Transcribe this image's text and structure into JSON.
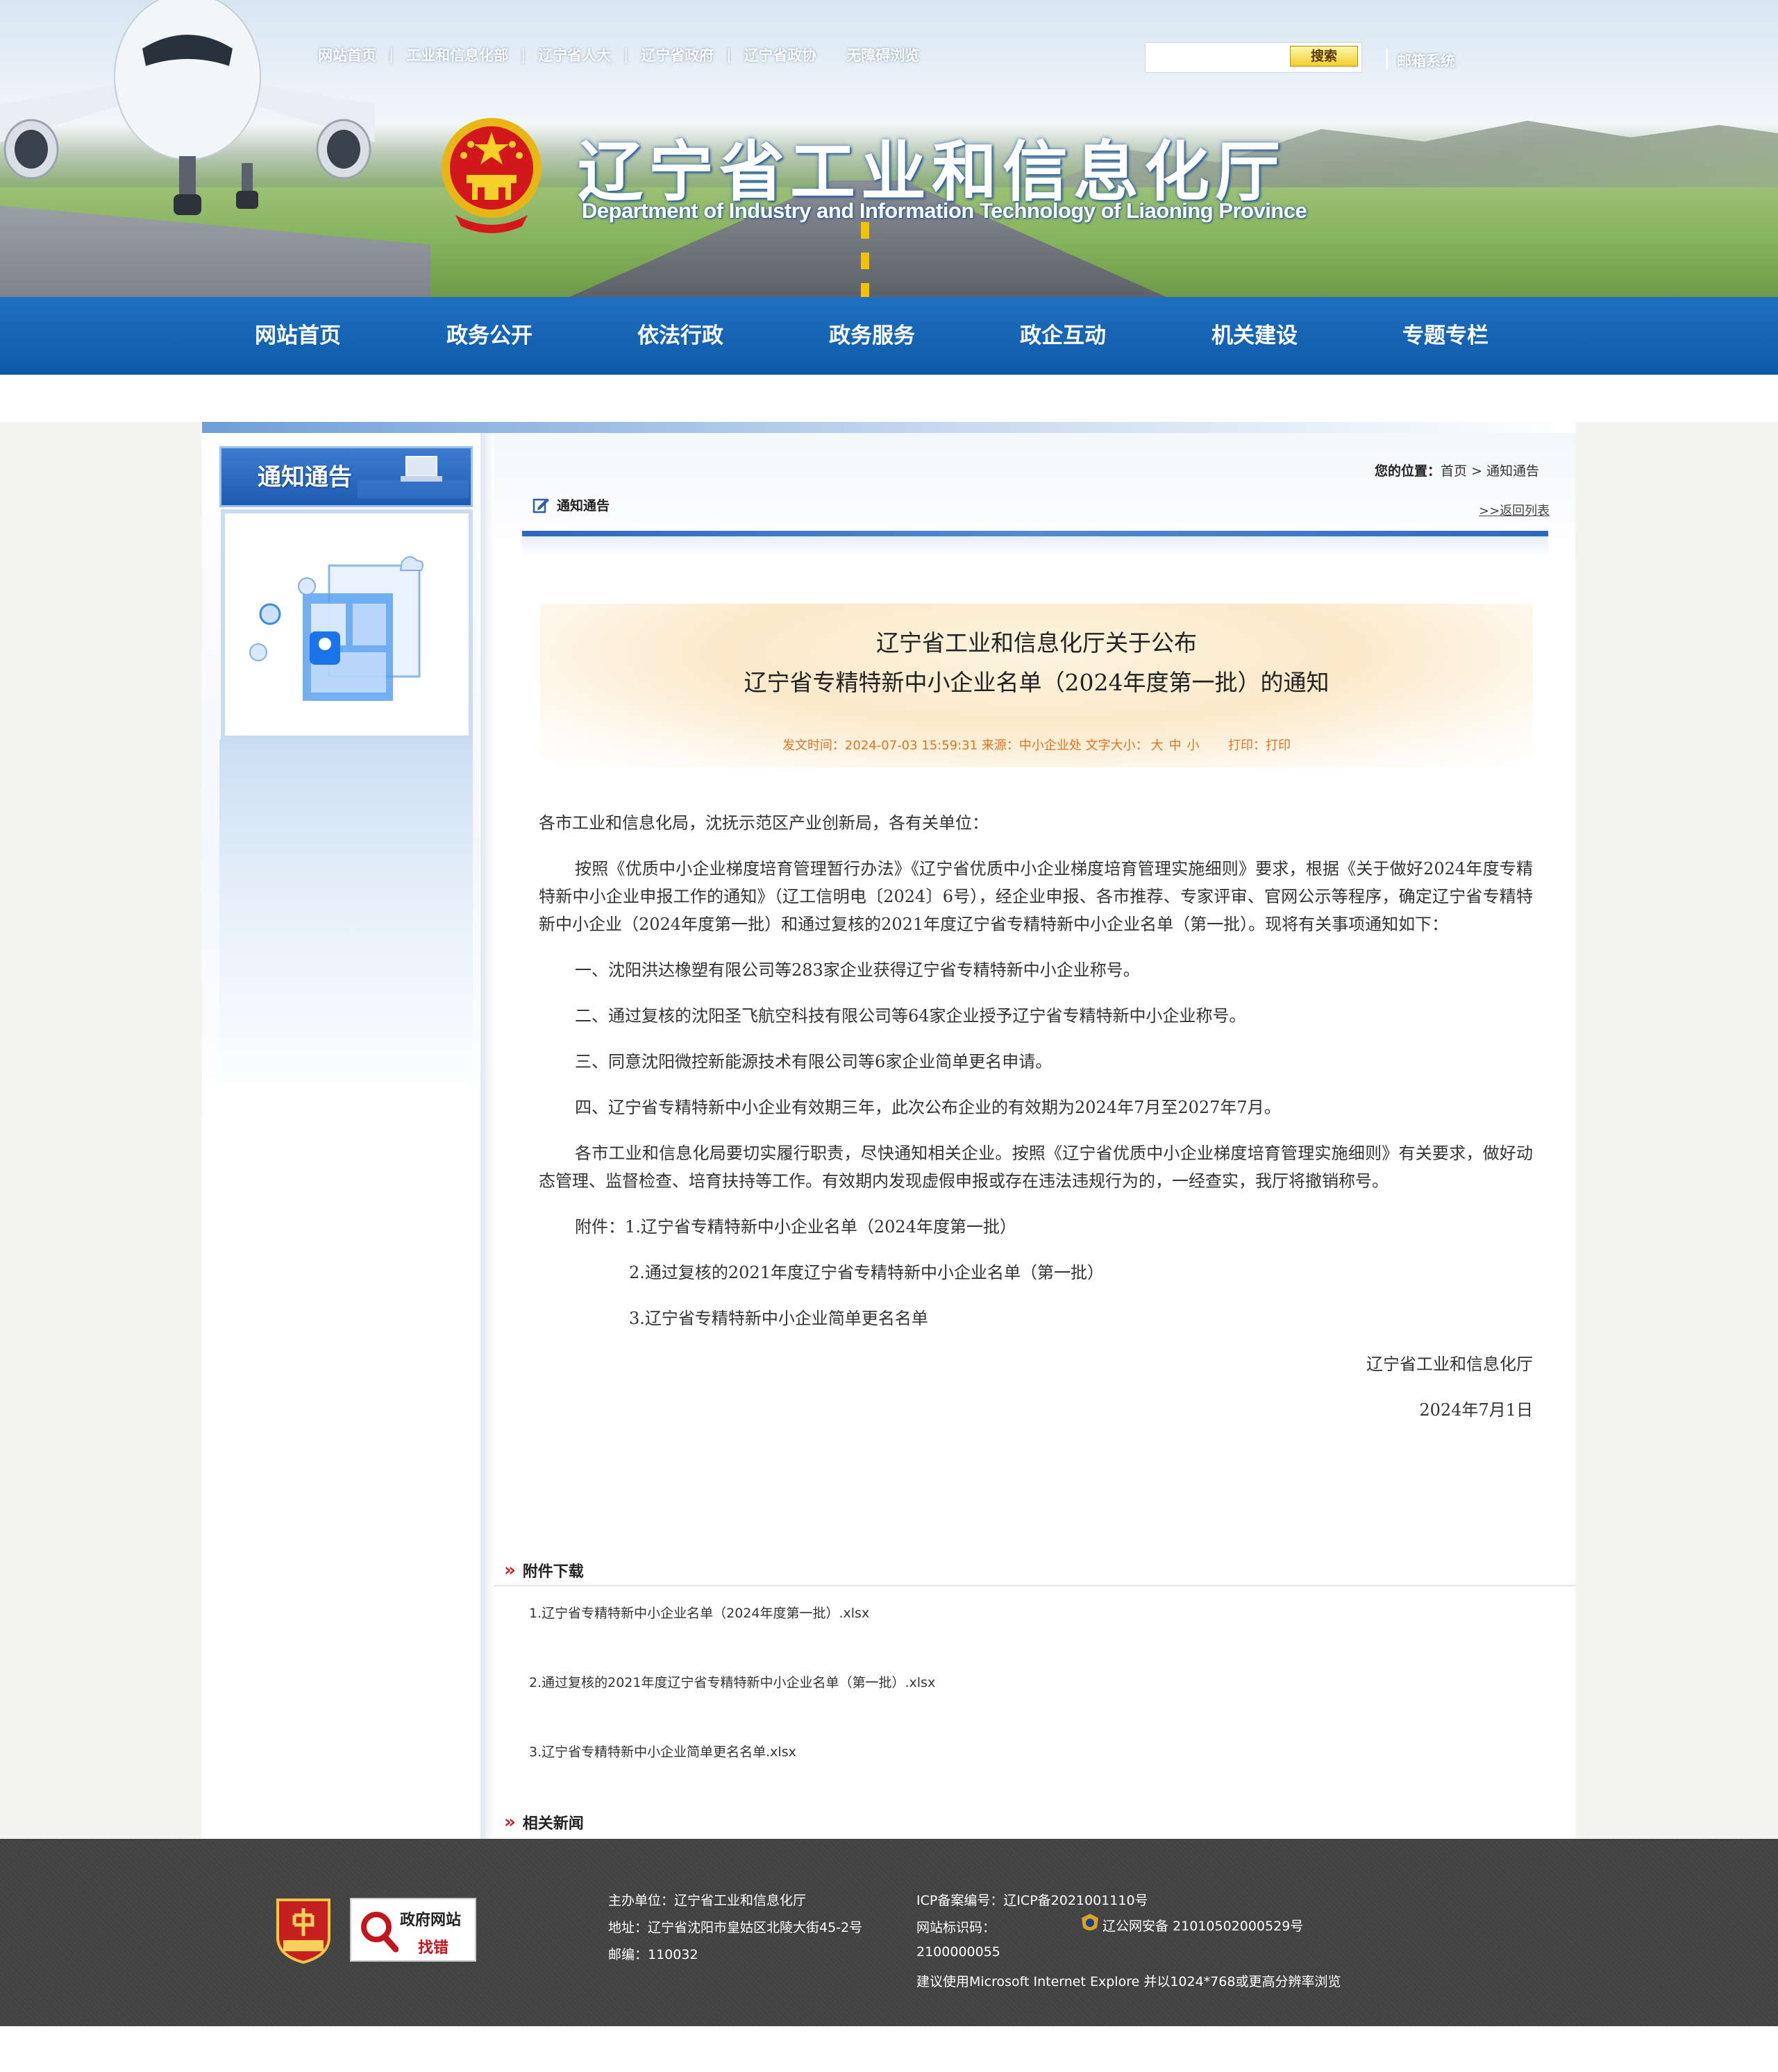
{
  "header": {
    "top_links": [
      "网站首页",
      "工业和信息化部",
      "辽宁省人大",
      "辽宁省政府",
      "辽宁省政协",
      "无障碍浏览"
    ],
    "search_placeholder": "",
    "search_button": "搜索",
    "mail_link": "邮箱系统",
    "site_title_cn": "辽宁省工业和信息化厅",
    "site_title_en": "Department of Industry and Information Technology of Liaoning Province",
    "emblem_icon": "national-emblem"
  },
  "nav": {
    "items": [
      "网站首页",
      "政务公开",
      "依法行政",
      "政务服务",
      "政企互动",
      "机关建设",
      "专题专栏"
    ]
  },
  "sidebar": {
    "title": "通知通告",
    "illustration_icon": "web-dashboard-illustration"
  },
  "article": {
    "breadcrumb_label": "您的位置：",
    "breadcrumb_home": "首页",
    "breadcrumb_sep": ">",
    "breadcrumb_current": "通知通告",
    "section_label": "通知通告",
    "back_link": ">>返回列表",
    "title_line1": "辽宁省工业和信息化厅关于公布",
    "title_line2": "辽宁省专精特新中小企业名单（2024年度第一批）的通知",
    "meta_pubtime": "发文时间：2024-07-03 15:59:31",
    "meta_source": "来源：中小企业处",
    "meta_fontsize_label": "文字大小：",
    "meta_size_large": "大",
    "meta_size_mid": "中",
    "meta_size_small": "小",
    "meta_print_label": "打印：",
    "meta_print": "打印",
    "paragraphs": {
      "p0": "各市工业和信息化局，沈抚示范区产业创新局，各有关单位：",
      "p1": "按照《优质中小企业梯度培育管理暂行办法》《辽宁省优质中小企业梯度培育管理实施细则》要求，根据《关于做好2024年度专精特新中小企业申报工作的通知》（辽工信明电〔2024〕6号），经企业申报、各市推荐、专家评审、官网公示等程序，确定辽宁省专精特新中小企业（2024年度第一批）和通过复核的2021年度辽宁省专精特新中小企业名单（第一批）。现将有关事项通知如下：",
      "p2": "一、沈阳洪达橡塑有限公司等283家企业获得辽宁省专精特新中小企业称号。",
      "p3": "二、通过复核的沈阳圣飞航空科技有限公司等64家企业授予辽宁省专精特新中小企业称号。",
      "p4": "三、同意沈阳微控新能源技术有限公司等6家企业简单更名申请。",
      "p5": "四、辽宁省专精特新中小企业有效期三年，此次公布企业的有效期为2024年7月至2027年7月。",
      "p6": "各市工业和信息化局要切实履行职责，尽快通知相关企业。按照《辽宁省优质中小企业梯度培育管理实施细则》有关要求，做好动态管理、监督检查、培育扶持等工作。有效期内发现虚假申报或存在违法违规行为的，一经查实，我厅将撤销称号。",
      "p7": "附件：1.辽宁省专精特新中小企业名单（2024年度第一批）",
      "p8": "2.通过复核的2021年度辽宁省专精特新中小企业名单（第一批）",
      "p9": "3.辽宁省专精特新中小企业简单更名名单",
      "p10": "辽宁省工业和信息化厅",
      "p11": "2024年7月1日"
    }
  },
  "attachments": {
    "title": "附件下载",
    "items": [
      "1.辽宁省专精特新中小企业名单（2024年度第一批）.xlsx",
      "2.通过复核的2021年度辽宁省专精特新中小企业名单（第一批）.xlsx",
      "3.辽宁省专精特新中小企业简单更名名单.xlsx"
    ]
  },
  "related": {
    "title": "相关新闻"
  },
  "footer": {
    "badge_icon": "party-organ-badge",
    "govfind_line1": "政府网站",
    "govfind_line2": "找错",
    "host": "主办单位：辽宁省工业和信息化厅",
    "address": "地址：辽宁省沈阳市皇姑区北陵大街45-2号",
    "postcode": "邮编：110032",
    "icp": "ICP备案编号：辽ICP备2021001110号",
    "site_id_label": "网站标识码：",
    "site_id": "2100000055",
    "police": "辽公网安备 21010502000529号",
    "browser_tip": "建议使用Microsoft Internet Explore 并以1024*768或更高分辨率浏览"
  },
  "colors": {
    "nav_blue": "#0e5aa8",
    "meta_orange": "#e37321",
    "mark_red": "#c8202c",
    "footer_gray": "#444444"
  }
}
